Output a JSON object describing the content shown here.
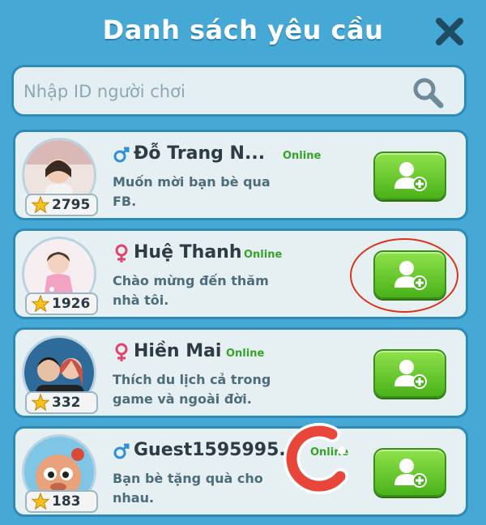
{
  "header": {
    "title": "Danh sách yêu cầu"
  },
  "search": {
    "placeholder": "Nhập ID người chơi"
  },
  "colors": {
    "background": "#46a8d5",
    "card": "#e6eff2",
    "button_green": "#5cc224",
    "male": "#2f8fd8",
    "female": "#e0456e",
    "online": "#37a22a",
    "highlight": "#d8341c"
  },
  "requests": [
    {
      "name": "Đỗ Trang N...",
      "gender": "male",
      "status": "Online",
      "message": "Muốn mời bạn bè qua FB.",
      "level": "2795",
      "icon": "add-friend-icon"
    },
    {
      "name": "Huệ Thanh",
      "gender": "female",
      "status": "Online",
      "message": "Chào mừng đến thăm nhà tôi.",
      "level": "1926",
      "icon": "add-friend-icon"
    },
    {
      "name": "Hiền Mai",
      "gender": "female",
      "status": "Online",
      "message": "Thích du lịch cả trong game và ngoài đời.",
      "level": "332",
      "icon": "add-friend-icon"
    },
    {
      "name": "Guest1595995...",
      "gender": "male",
      "status": "Online",
      "message": "Bạn bè tặng quà cho nhau.",
      "level": "183",
      "icon": "add-friend-icon"
    }
  ]
}
